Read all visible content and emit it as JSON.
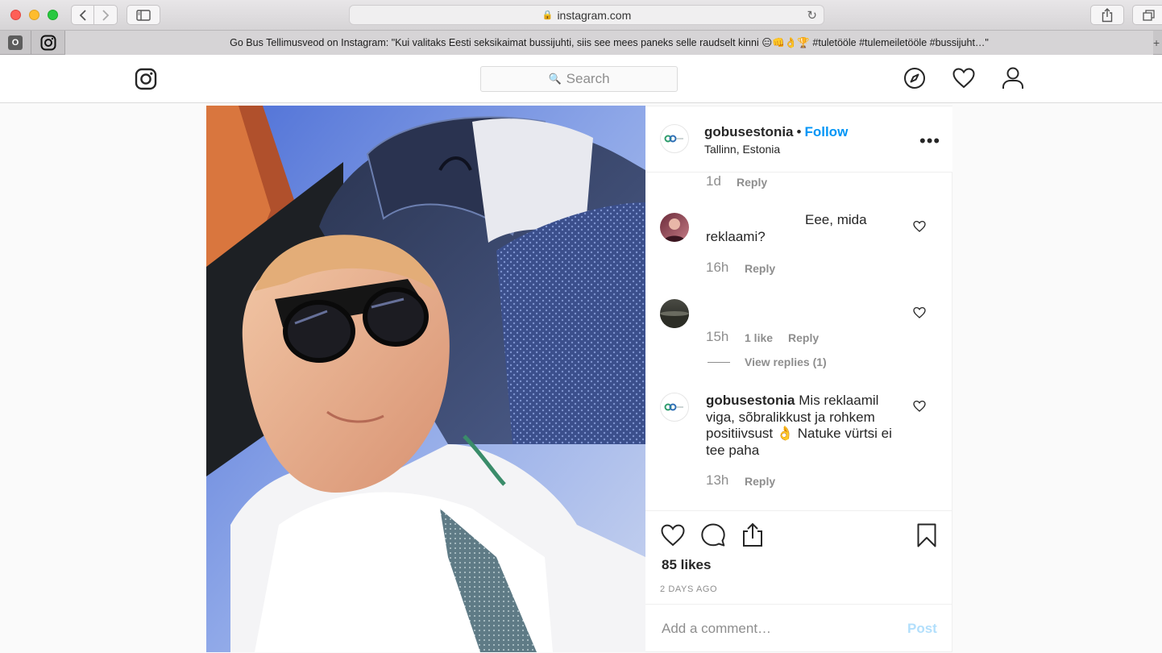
{
  "browser": {
    "url": "instagram.com",
    "tab_title": "Go Bus Tellimusveod on Instagram: \"Kui valitaks Eesti seksikaimat bussijuhti, siis see mees paneks selle raudselt kinni 😑👊👌🏆 #tuletööle #tulemeiletööle #bussijuht…\"",
    "tab_favicon_letter": "O"
  },
  "header": {
    "search_placeholder": "Search"
  },
  "post": {
    "username": "gobusestonia",
    "separator": "•",
    "follow_label": "Follow",
    "location": "Tallinn, Estonia",
    "more_label": "•••",
    "comments": [
      {
        "time": "1d",
        "reply": "Reply"
      },
      {
        "text": "Eee, mida reklaami?",
        "time": "16h",
        "reply": "Reply"
      },
      {
        "text": "",
        "time": "15h",
        "likes": "1 like",
        "reply": "Reply",
        "view_replies": "View replies (1)"
      },
      {
        "user": "gobusestonia",
        "text": "Mis reklaamil viga, sõbralikkust ja rohkem positiivsust 👌 Natuke vürtsi ei tee paha",
        "time": "13h",
        "reply": "Reply"
      }
    ],
    "likes": "85 likes",
    "date": "2 DAYS AGO",
    "comment_placeholder": "Add a comment…",
    "post_label": "Post"
  }
}
